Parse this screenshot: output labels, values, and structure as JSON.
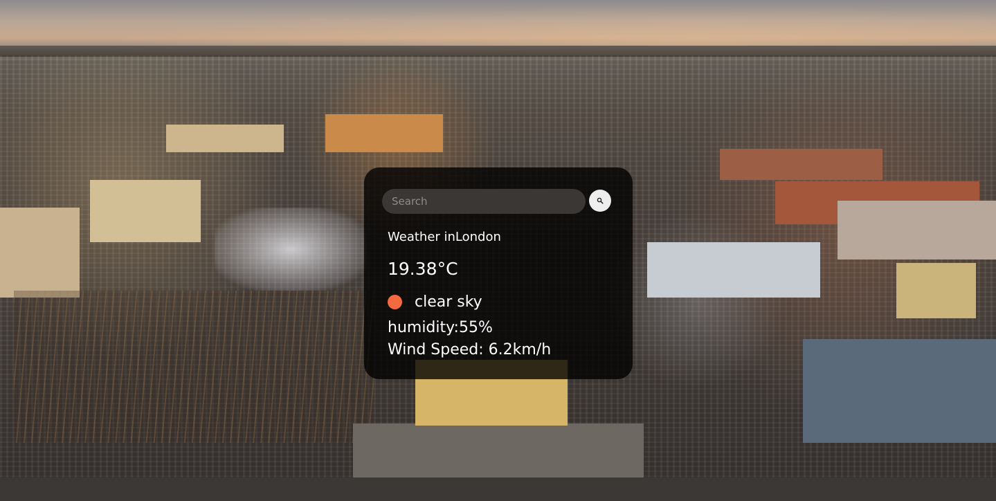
{
  "search": {
    "placeholder": "Search",
    "value": ""
  },
  "weather": {
    "title": "Weather inLondon",
    "temperature": "19.38°C",
    "description": "clear sky",
    "humidity": "humidity:55%",
    "wind_speed": "Wind Speed: 6.2km/h",
    "icon": "clear-sky-icon"
  },
  "colors": {
    "card_background": "#000000",
    "icon_accent": "#f26a3f",
    "text": "#ffffff"
  }
}
